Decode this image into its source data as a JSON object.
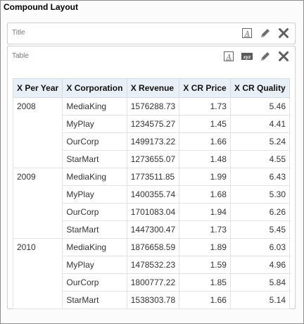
{
  "layout": {
    "title": "Compound Layout"
  },
  "panels": {
    "title_panel": {
      "label": "Title"
    },
    "table_panel": {
      "label": "Table"
    }
  },
  "icons": {
    "format_text": "format-text-icon",
    "format_xyz": "format-data-icon",
    "edit": "pencil-icon",
    "remove": "close-icon"
  },
  "table": {
    "columns": [
      "X Per Year",
      "X Corporation",
      "X Revenue",
      "X CR Price",
      "X CR Quality"
    ],
    "groups": [
      {
        "year": "2008",
        "rows": [
          {
            "corp": "MediaKing",
            "revenue": "1576288.73",
            "price": "1.73",
            "quality": "5.46"
          },
          {
            "corp": "MyPlay",
            "revenue": "1234575.27",
            "price": "1.45",
            "quality": "4.41"
          },
          {
            "corp": "OurCorp",
            "revenue": "1499173.22",
            "price": "1.66",
            "quality": "5.24"
          },
          {
            "corp": "StarMart",
            "revenue": "1273655.07",
            "price": "1.48",
            "quality": "4.55"
          }
        ]
      },
      {
        "year": "2009",
        "rows": [
          {
            "corp": "MediaKing",
            "revenue": "1773511.85",
            "price": "1.99",
            "quality": "6.43"
          },
          {
            "corp": "MyPlay",
            "revenue": "1400355.74",
            "price": "1.68",
            "quality": "5.30"
          },
          {
            "corp": "OurCorp",
            "revenue": "1701083.04",
            "price": "1.94",
            "quality": "6.26"
          },
          {
            "corp": "StarMart",
            "revenue": "1447300.47",
            "price": "1.73",
            "quality": "5.45"
          }
        ]
      },
      {
        "year": "2010",
        "rows": [
          {
            "corp": "MediaKing",
            "revenue": "1876658.59",
            "price": "1.89",
            "quality": "6.03"
          },
          {
            "corp": "MyPlay",
            "revenue": "1478532.23",
            "price": "1.59",
            "quality": "4.96"
          },
          {
            "corp": "OurCorp",
            "revenue": "1800777.22",
            "price": "1.85",
            "quality": "5.84"
          },
          {
            "corp": "StarMart",
            "revenue": "1538303.78",
            "price": "1.66",
            "quality": "5.14"
          }
        ]
      }
    ]
  }
}
